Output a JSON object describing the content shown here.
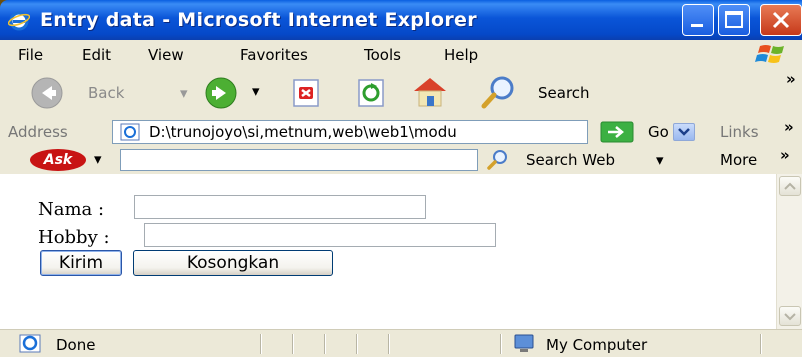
{
  "window": {
    "title": "Entry data - Microsoft Internet Explorer"
  },
  "menu": {
    "items": [
      "File",
      "Edit",
      "View",
      "Favorites",
      "Tools",
      "Help"
    ]
  },
  "toolbar": {
    "back_label": "Back",
    "search_label": "Search",
    "overflow": "»"
  },
  "address": {
    "label": "Address",
    "url": "D:\\trunojoyo\\si,metnum,web\\web1\\modu",
    "go_label": "Go",
    "links_label": "Links",
    "overflow": "»"
  },
  "askbar": {
    "logo_text": "Ask",
    "search_web_label": "Search Web",
    "more_label": "More",
    "more_arrow": "»"
  },
  "form": {
    "nama_label": "Nama :",
    "hobby_label": "Hobby :",
    "nama_value": "",
    "hobby_value": "",
    "submit_label": "Kirim",
    "reset_label": "Kosongkan"
  },
  "status": {
    "text": "Done",
    "zone": "My Computer"
  },
  "colors": {
    "titlebar": "#0a55d8",
    "chrome": "#ece9d8",
    "close_button": "#c6391a"
  }
}
